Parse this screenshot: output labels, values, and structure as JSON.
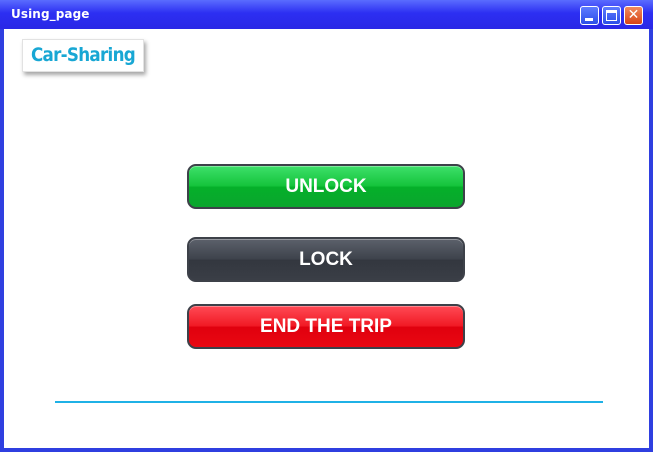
{
  "window": {
    "title": "Using_page",
    "controls": {
      "minimize": "minimize-icon",
      "maximize": "maximize-icon",
      "close_glyph": "✕"
    },
    "frame_color": "#2f3fe0"
  },
  "logo": {
    "text": "Car-Sharing",
    "color": "#18a7d4"
  },
  "actions": {
    "unlock_label": "UNLOCK",
    "lock_label": "LOCK",
    "end_trip_label": "END THE TRIP",
    "colors": {
      "unlock": "#15c43c",
      "lock": "#3e434c",
      "end_trip": "#f11a25"
    }
  },
  "divider_color": "#1fb1e6"
}
